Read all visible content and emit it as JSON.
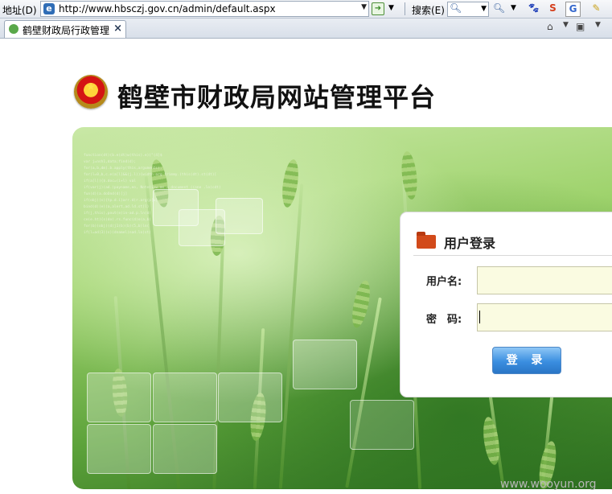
{
  "browser": {
    "address_label": "地址(D)",
    "url": "http://www.hbsczj.gov.cn/admin/default.aspx",
    "search_label": "搜索(E)",
    "tab_title": "鹤壁财政局行政管理",
    "toolbar_icons": [
      "search-icon",
      "baidu-paw-icon",
      "sogou-icon",
      "google-icon",
      "highlighter-icon"
    ]
  },
  "page": {
    "site_title": "鹤壁市财政局网站管理平台"
  },
  "login": {
    "title": "用户登录",
    "username_label": "用户名:",
    "password_label": "密　码:",
    "username_value": "",
    "password_value": "",
    "submit_label": "登 录"
  },
  "watermark": "www.wooyun.org",
  "colors": {
    "field_bg": "#fafbe1",
    "button_blue": "#3a8ee0",
    "folder_icon": "#d24a1a",
    "banner_green": "#5ca23a"
  }
}
